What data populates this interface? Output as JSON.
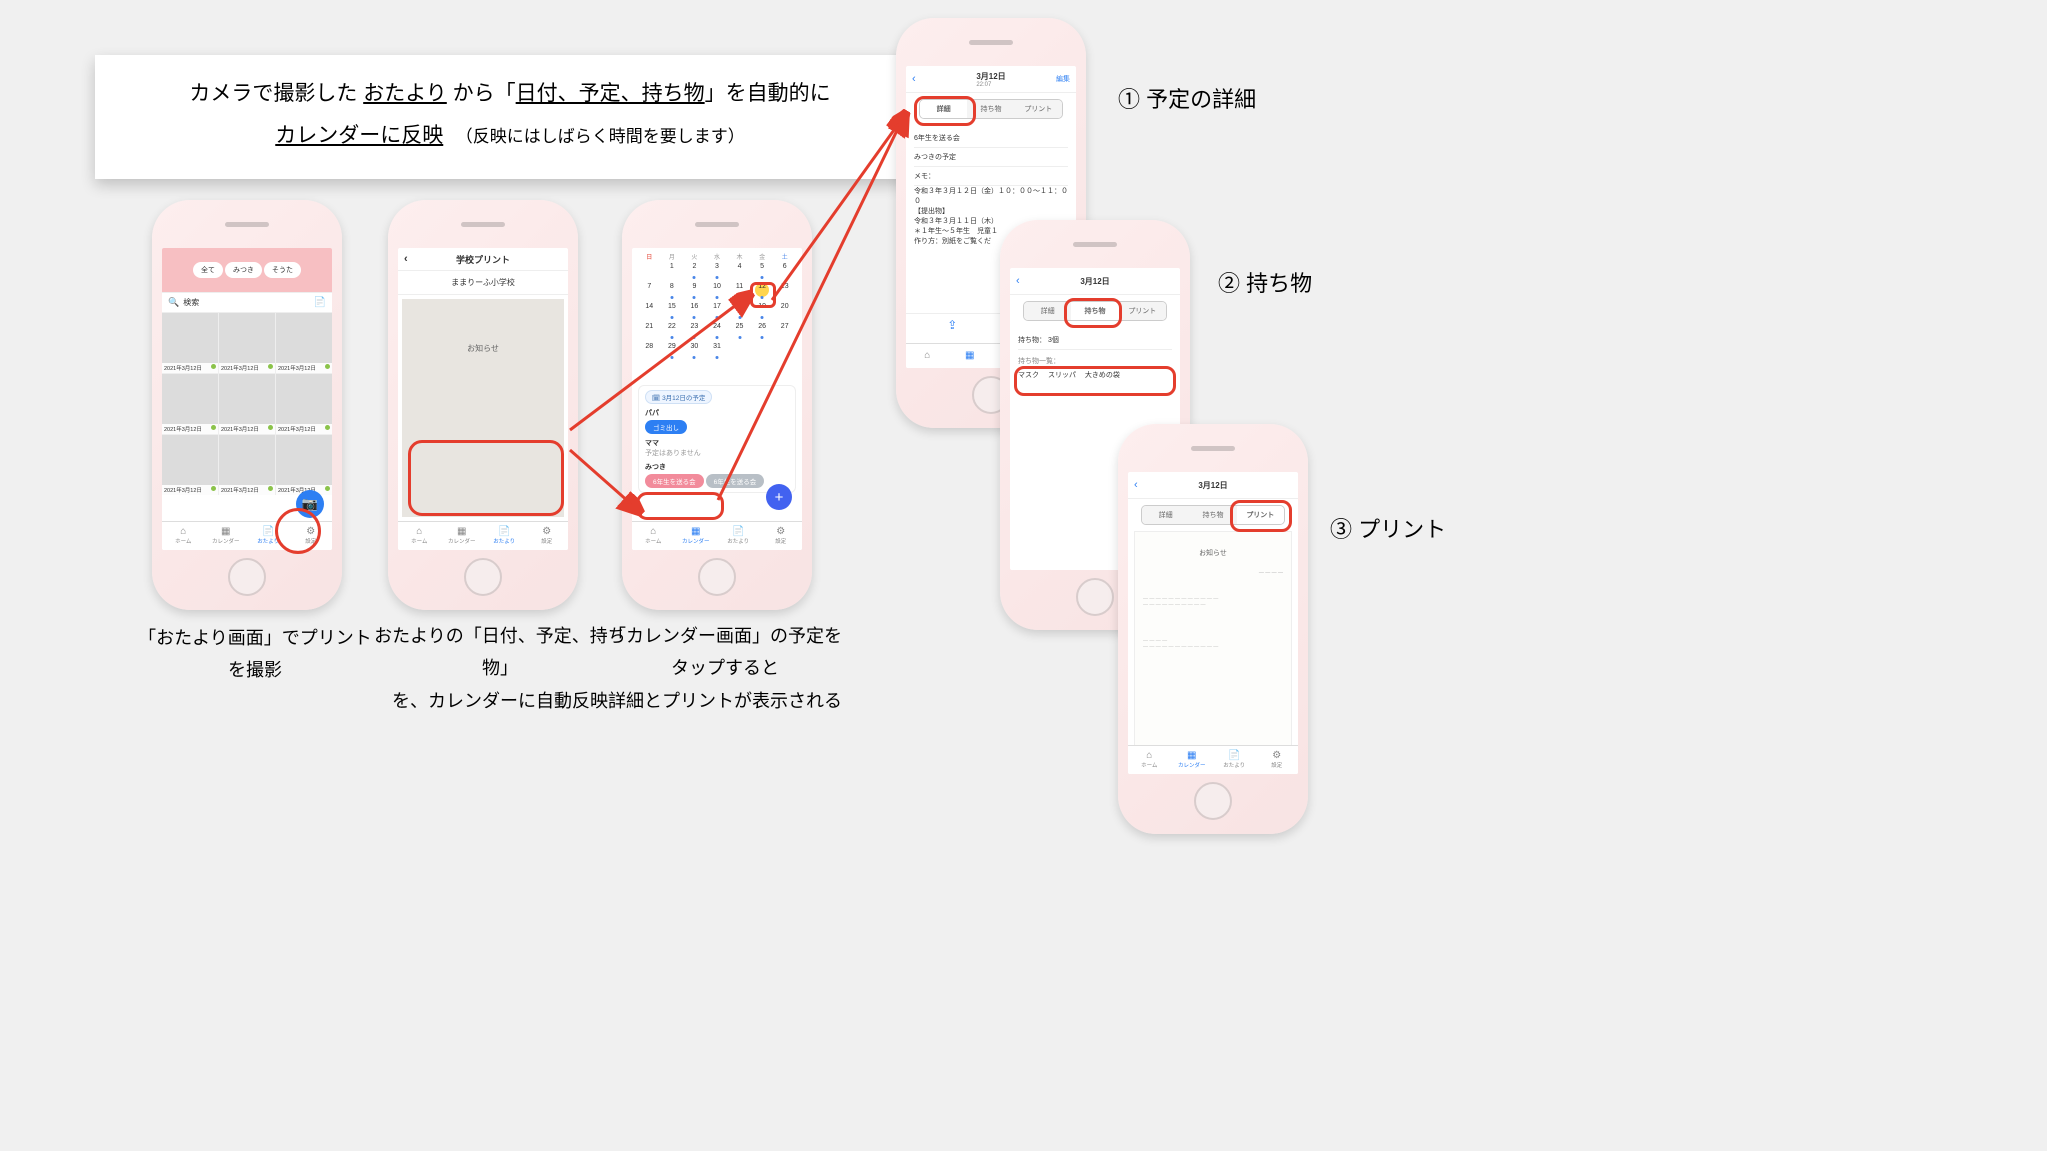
{
  "title": {
    "line1_pre": "カメラで撮影した ",
    "line1_u1": "おたより",
    "line1_mid": " から「",
    "line1_u2": "日付、予定、持ち物",
    "line1_post": "」を自動的に",
    "line2_u": "カレンダーに反映",
    "line2_sub": "（反映にはしばらく時間を要します）"
  },
  "captions": {
    "p1": "「おたより画面」でプリントを撮影",
    "p2a": "おたよりの「日付、予定、持ち物」",
    "p2b": "を、カレンダーに自動反映",
    "p3a": "「カレンダー画面」の予定を",
    "p3b": "タップすると",
    "p3c": "詳細とプリントが表示される"
  },
  "side": {
    "s1": "① 予定の詳細",
    "s2": "② 持ち物",
    "s3": "③ プリント"
  },
  "tabbar": {
    "home": "ホーム",
    "calendar": "カレンダー",
    "otayori": "おたより",
    "settings": "設定"
  },
  "p1": {
    "tabs": [
      "全て",
      "みつき",
      "そうた"
    ],
    "search": "検索",
    "date": "2021年3月12日"
  },
  "p2": {
    "title": "学校プリント",
    "school": "ままりーふ小学校",
    "doctitle": "お知らせ"
  },
  "p3": {
    "days": [
      "日",
      "月",
      "火",
      "水",
      "木",
      "金",
      "土"
    ],
    "dates": [
      "",
      "1",
      "2",
      "3",
      "4",
      "5",
      "6",
      "7",
      "8",
      "9",
      "10",
      "11",
      "12",
      "13",
      "14",
      "15",
      "16",
      "17",
      "18",
      "19",
      "20",
      "21",
      "22",
      "23",
      "24",
      "25",
      "26",
      "27",
      "28",
      "29",
      "30",
      "31",
      "",
      "",
      "",
      ""
    ],
    "sched_badge": "3月12日の予定",
    "papa": "パパ",
    "papa_ev": "ゴミ出し",
    "mama": "ママ",
    "mama_ev": "予定はありません",
    "kid": "みつき",
    "kid_ev1": "6年生を送る会",
    "kid_ev2": "6年生を送る会"
  },
  "p4": {
    "date": "3月12日",
    "time": "22:07",
    "edit": "編集",
    "seg": [
      "詳細",
      "持ち物",
      "プリント"
    ],
    "ev": "6年生を送る会",
    "who": "みつきの予定",
    "memo": "メモ：",
    "l1": "令和３年３月１２日（金）１０：００〜１１：００",
    "l2": "【提出物】",
    "l3": "令和３年３月１１日（木）",
    "l4": "＊１年生〜５年生　児童１",
    "l5": "作り方：別紙をご覧くだ"
  },
  "p5": {
    "date": "3月12日",
    "seg": [
      "詳細",
      "持ち物",
      "プリント"
    ],
    "count": "持ち物： 3個",
    "listlabel": "持ち物一覧：",
    "items": [
      "マスク",
      "スリッパ",
      "大きめの袋"
    ]
  },
  "p6": {
    "date": "3月12日",
    "seg": [
      "詳細",
      "持ち物",
      "プリント"
    ],
    "doctitle": "お知らせ"
  }
}
